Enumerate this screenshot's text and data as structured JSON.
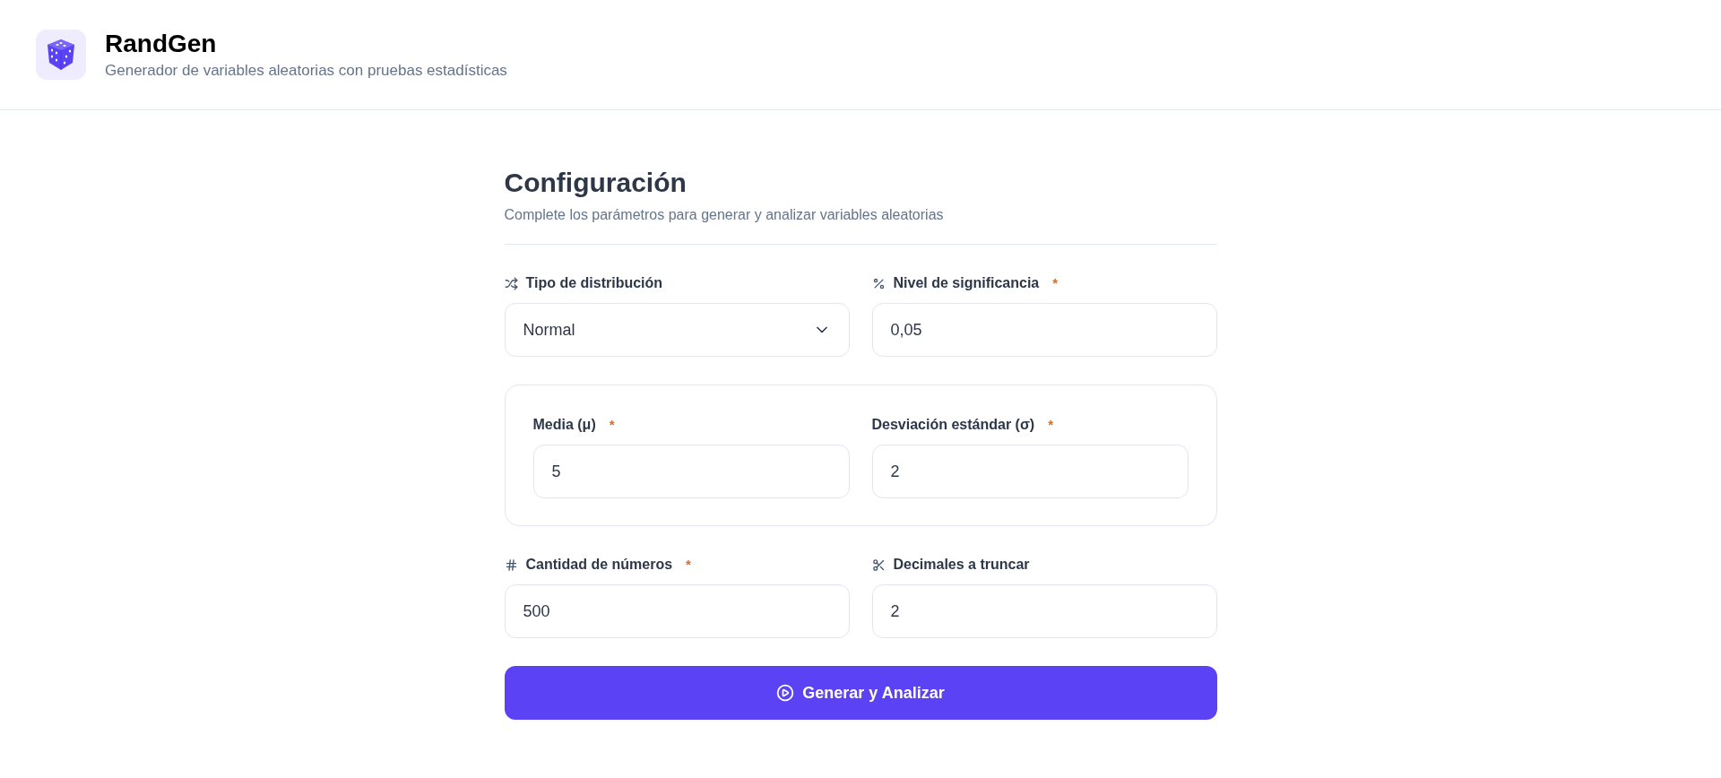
{
  "header": {
    "title": "RandGen",
    "subtitle": "Generador de variables aleatorias con pruebas estadísticas"
  },
  "config": {
    "title": "Configuración",
    "subtitle": "Complete los parámetros para generar y analizar variables aleatorias"
  },
  "main_fields": [
    {
      "kind": "select",
      "label": "Tipo de distribución",
      "value": "Normal"
    },
    {
      "kind": "input",
      "label": "Nivel de significancia",
      "required_mark": "*",
      "value": "0,05"
    }
  ],
  "parameters": [
    {
      "kind": "input",
      "label": "Media (μ)",
      "required_mark": "*",
      "value": "5"
    },
    {
      "kind": "input",
      "label": "Desviación estándar (σ)",
      "required_mark": "*",
      "value": "2"
    }
  ],
  "more_fields": [
    {
      "kind": "input",
      "label": "Cantidad de números",
      "required_mark": "*",
      "value": "500"
    },
    {
      "kind": "input",
      "label": "Decimales a truncar",
      "value": "2"
    }
  ],
  "submit_button": {
    "label": "Generar y Analizar"
  }
}
